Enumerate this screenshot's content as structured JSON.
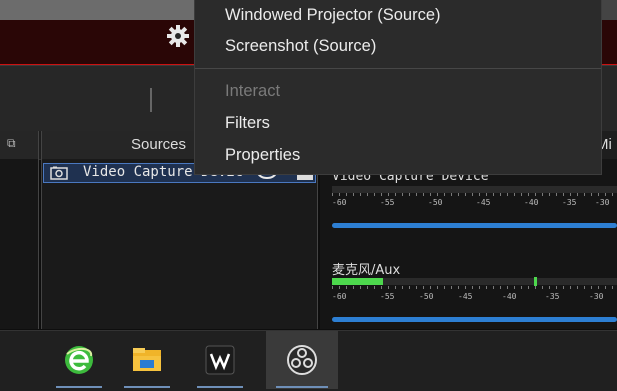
{
  "context_menu": {
    "items": [
      {
        "label": "Windowed Projector (Source)",
        "enabled": true
      },
      {
        "label": "Screenshot (Source)",
        "enabled": true
      },
      {
        "label": "Interact",
        "enabled": false
      },
      {
        "label": "Filters",
        "enabled": true
      },
      {
        "label": "Properties",
        "enabled": true
      }
    ]
  },
  "docks": {
    "scenes_icon": "dock-icon",
    "sources_title": "Sources",
    "mixer_title": "Mi"
  },
  "sources": {
    "items": [
      {
        "label": "Video Capture Devic",
        "icon": "camera-icon"
      }
    ]
  },
  "mixer": {
    "channels": [
      {
        "name": "Video Capture Device",
        "scale": [
          "-60",
          "-55",
          "-50",
          "-45",
          "-40",
          "-35",
          "-30"
        ],
        "level_fraction": 0.0
      },
      {
        "name": "麦克风/Aux",
        "scale": [
          "-60",
          "-55",
          "-50",
          "-45",
          "-40",
          "-35",
          "-30"
        ],
        "level_fraction": 0.18
      }
    ]
  },
  "taskbar": {
    "apps": [
      "ie-browser-icon",
      "file-explorer-icon",
      "wps-office-icon",
      "obs-studio-icon"
    ],
    "active": "obs-studio-icon"
  },
  "colors": {
    "accent": "#2d7fd3",
    "selection": "#1f3150",
    "meter_green": "#4dd84d"
  }
}
